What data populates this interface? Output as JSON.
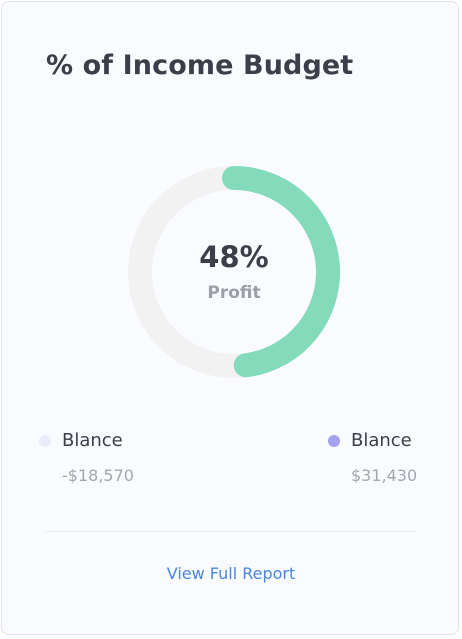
{
  "card": {
    "title": "% of Income Budget"
  },
  "donut": {
    "percent": 48,
    "value_text": "48%",
    "sub_label": "Profit",
    "colors": {
      "track": "#f2f2f2",
      "progress": "#84dbbb"
    }
  },
  "legend": {
    "left": {
      "label": "Blance",
      "value": "-$18,570",
      "color": "#ecebfa"
    },
    "right": {
      "label": "Blance",
      "value": "$31,430",
      "color": "#a4a1ee"
    }
  },
  "footer": {
    "link_label": "View Full Report",
    "link_color": "#4a86dd"
  }
}
